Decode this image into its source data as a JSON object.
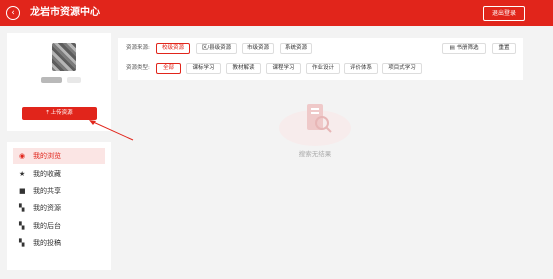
{
  "header": {
    "back_icon": "chevron-left-icon",
    "title": "龙岩市资源中心",
    "logout_label": "退出登录",
    "brand_color": "#e1251b"
  },
  "profile": {
    "upload_label": "上传资源",
    "upload_icon": "upload-icon"
  },
  "menu": {
    "items": [
      {
        "label": "我的浏览",
        "icon": "eye-icon",
        "active": true
      },
      {
        "label": "我的收藏",
        "icon": "star-icon",
        "active": false
      },
      {
        "label": "我的共享",
        "icon": "share-icon",
        "active": false
      },
      {
        "label": "我的资源",
        "icon": "grid-icon",
        "active": false
      },
      {
        "label": "我的后台",
        "icon": "grid-icon",
        "active": false
      },
      {
        "label": "我的投稿",
        "icon": "grid-icon",
        "active": false
      }
    ]
  },
  "filters": {
    "source_label": "资源来源:",
    "source_options": [
      "校级资源",
      "区/县级资源",
      "市级资源",
      "系统资源"
    ],
    "source_selected": "校级资源",
    "type_label": "资源类型:",
    "type_options": [
      "全部",
      "课标学习",
      "教材解读",
      "课程学习",
      "作业设计",
      "评价体系",
      "项目式学习"
    ],
    "type_selected": "全部",
    "book_filter_label": "书册筛选",
    "reset_label": "重置"
  },
  "results": {
    "empty_text": "搜索无结果"
  }
}
